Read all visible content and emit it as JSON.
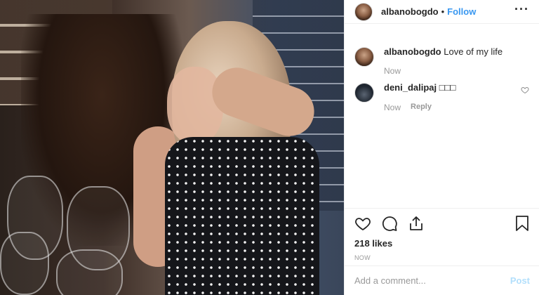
{
  "post": {
    "author": "albanobogdo",
    "separator": "•",
    "follow_label": "Follow",
    "more_label": "···"
  },
  "caption": {
    "username": "albanobogdo",
    "text": "Love of my life",
    "time": "Now"
  },
  "comments": [
    {
      "username": "deni_dalipaj",
      "text": "□□□",
      "time": "Now",
      "reply_label": "Reply"
    }
  ],
  "actions": {
    "likes": "218 likes",
    "timestamp": "NOW"
  },
  "add_comment": {
    "placeholder": "Add a comment...",
    "post_label": "Post"
  },
  "colors": {
    "link": "#3897f0",
    "post_disabled": "#b2dffc",
    "muted": "#999999"
  },
  "icons": [
    "more-icon",
    "heart-icon",
    "comment-icon",
    "share-icon",
    "bookmark-icon",
    "small-heart-icon"
  ]
}
